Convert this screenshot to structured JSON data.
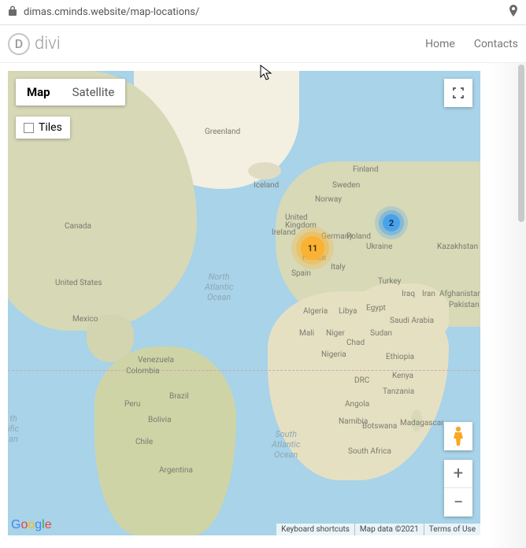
{
  "address_bar": {
    "url": "dimas.cminds.website/map-locations/"
  },
  "header": {
    "logo_letter": "D",
    "logo_text": "divi",
    "nav": {
      "home": "Home",
      "contacts": "Contacts"
    }
  },
  "map_controls": {
    "map_label": "Map",
    "satellite_label": "Satellite",
    "tiles_label": "Tiles",
    "zoom_in": "+",
    "zoom_out": "−"
  },
  "clusters": {
    "c11": "11",
    "c2": "2"
  },
  "ocean_labels": {
    "north_atlantic": "North\nAtlantic\nOcean",
    "south_atlantic": "South\nAtlantic\nOcean",
    "pacific_frag": "th\nific\nan"
  },
  "country_labels": {
    "greenland": "Greenland",
    "iceland": "Iceland",
    "finland": "Finland",
    "sweden": "Sweden",
    "norway": "Norway",
    "uk": "United\nKingdom",
    "ireland": "Ireland",
    "germany": "Germany",
    "poland": "Poland",
    "ukraine": "Ukraine",
    "france": "France",
    "spain": "Spain",
    "italy": "Italy",
    "turkey": "Turkey",
    "iraq": "Iraq",
    "iran": "Iran",
    "afghanistan": "Afghanistan",
    "pakistan": "Pakistan",
    "kazakhstan": "Kazakhstan",
    "egypt": "Egypt",
    "libya": "Libya",
    "algeria": "Algeria",
    "mali": "Mali",
    "niger": "Niger",
    "chad": "Chad",
    "sudan": "Sudan",
    "saudi": "Saudi Arabia",
    "nigeria": "Nigeria",
    "ethiopia": "Ethiopia",
    "kenya": "Kenya",
    "drc": "DRC",
    "tanzania": "Tanzania",
    "angola": "Angola",
    "namibia": "Namibia",
    "botswana": "Botswana",
    "madagascar": "Madagascar",
    "southafrica": "South Africa",
    "canada": "Canada",
    "usa": "United States",
    "mexico": "Mexico",
    "venezuela": "Venezuela",
    "colombia": "Colombia",
    "brazil": "Brazil",
    "peru": "Peru",
    "bolivia": "Bolivia",
    "chile": "Chile",
    "argentina": "Argentina"
  },
  "attribution": {
    "google": [
      "G",
      "o",
      "o",
      "g",
      "l",
      "e"
    ],
    "shortcuts": "Keyboard shortcuts",
    "mapdata": "Map data ©2021",
    "terms": "Terms of Use"
  }
}
